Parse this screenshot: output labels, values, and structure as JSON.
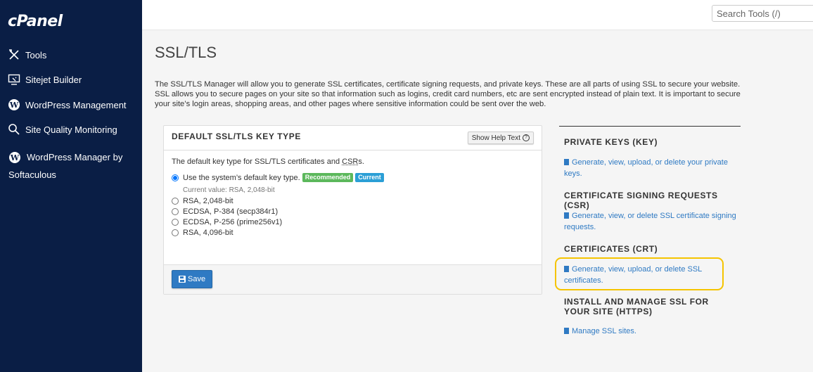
{
  "sidebar": {
    "logo": "cPanel",
    "items": [
      {
        "label": "Tools",
        "icon": "tools-icon"
      },
      {
        "label": "Sitejet Builder",
        "icon": "sitejet-icon"
      },
      {
        "label": "WordPress Management",
        "icon": "wordpress-icon"
      },
      {
        "label": "Site Quality Monitoring",
        "icon": "search-monitor-icon"
      },
      {
        "label": "WordPress Manager by Softaculous",
        "icon": "wordpress-icon"
      }
    ]
  },
  "topbar": {
    "search_placeholder": "Search Tools (/)"
  },
  "page": {
    "title": "SSL/TLS",
    "intro": "The SSL/TLS Manager will allow you to generate SSL certificates, certificate signing requests, and private keys. These are all parts of using SSL to secure your website. SSL allows you to secure pages on your site so that information such as logins, credit card numbers, etc are sent encrypted instead of plain text. It is important to secure your site’s login areas, shopping areas, and other pages where sensitive information could be sent over the web."
  },
  "panel": {
    "title": "DEFAULT SSL/TLS KEY TYPE",
    "help_button": "Show Help Text",
    "desc_prefix": "The default key type for SSL/TLS certificates and ",
    "desc_abbr": "CSR",
    "desc_suffix": "s.",
    "options": [
      {
        "label": "Use the system’s default key type.",
        "checked": true
      },
      {
        "label": "RSA, 2,048-bit",
        "checked": false
      },
      {
        "label": "ECDSA, P-384 (secp384r1)",
        "checked": false
      },
      {
        "label": "ECDSA, P-256 (prime256v1)",
        "checked": false
      },
      {
        "label": "RSA, 4,096-bit",
        "checked": false
      }
    ],
    "badge_recommended": "Recommended",
    "badge_current": "Current",
    "current_value": "Current value: RSA, 2,048-bit",
    "save_label": "Save"
  },
  "sections": [
    {
      "heading": "PRIVATE KEYS (KEY)",
      "link": "Generate, view, upload, or delete your private keys."
    },
    {
      "heading": "CERTIFICATE SIGNING REQUESTS (CSR)",
      "link": "Generate, view, or delete SSL certificate signing requests."
    },
    {
      "heading": "CERTIFICATES (CRT)",
      "link": "Generate, view, upload, or delete SSL certificates."
    },
    {
      "heading": "INSTALL AND MANAGE SSL FOR YOUR SITE (HTTPS)",
      "link": "Manage SSL sites."
    }
  ],
  "colors": {
    "sidebar_bg": "#0a1e45",
    "link": "#2f7ac3",
    "highlight": "#f5c400",
    "badge_recommended": "#5cb85c",
    "badge_current": "#2b9fd6"
  }
}
